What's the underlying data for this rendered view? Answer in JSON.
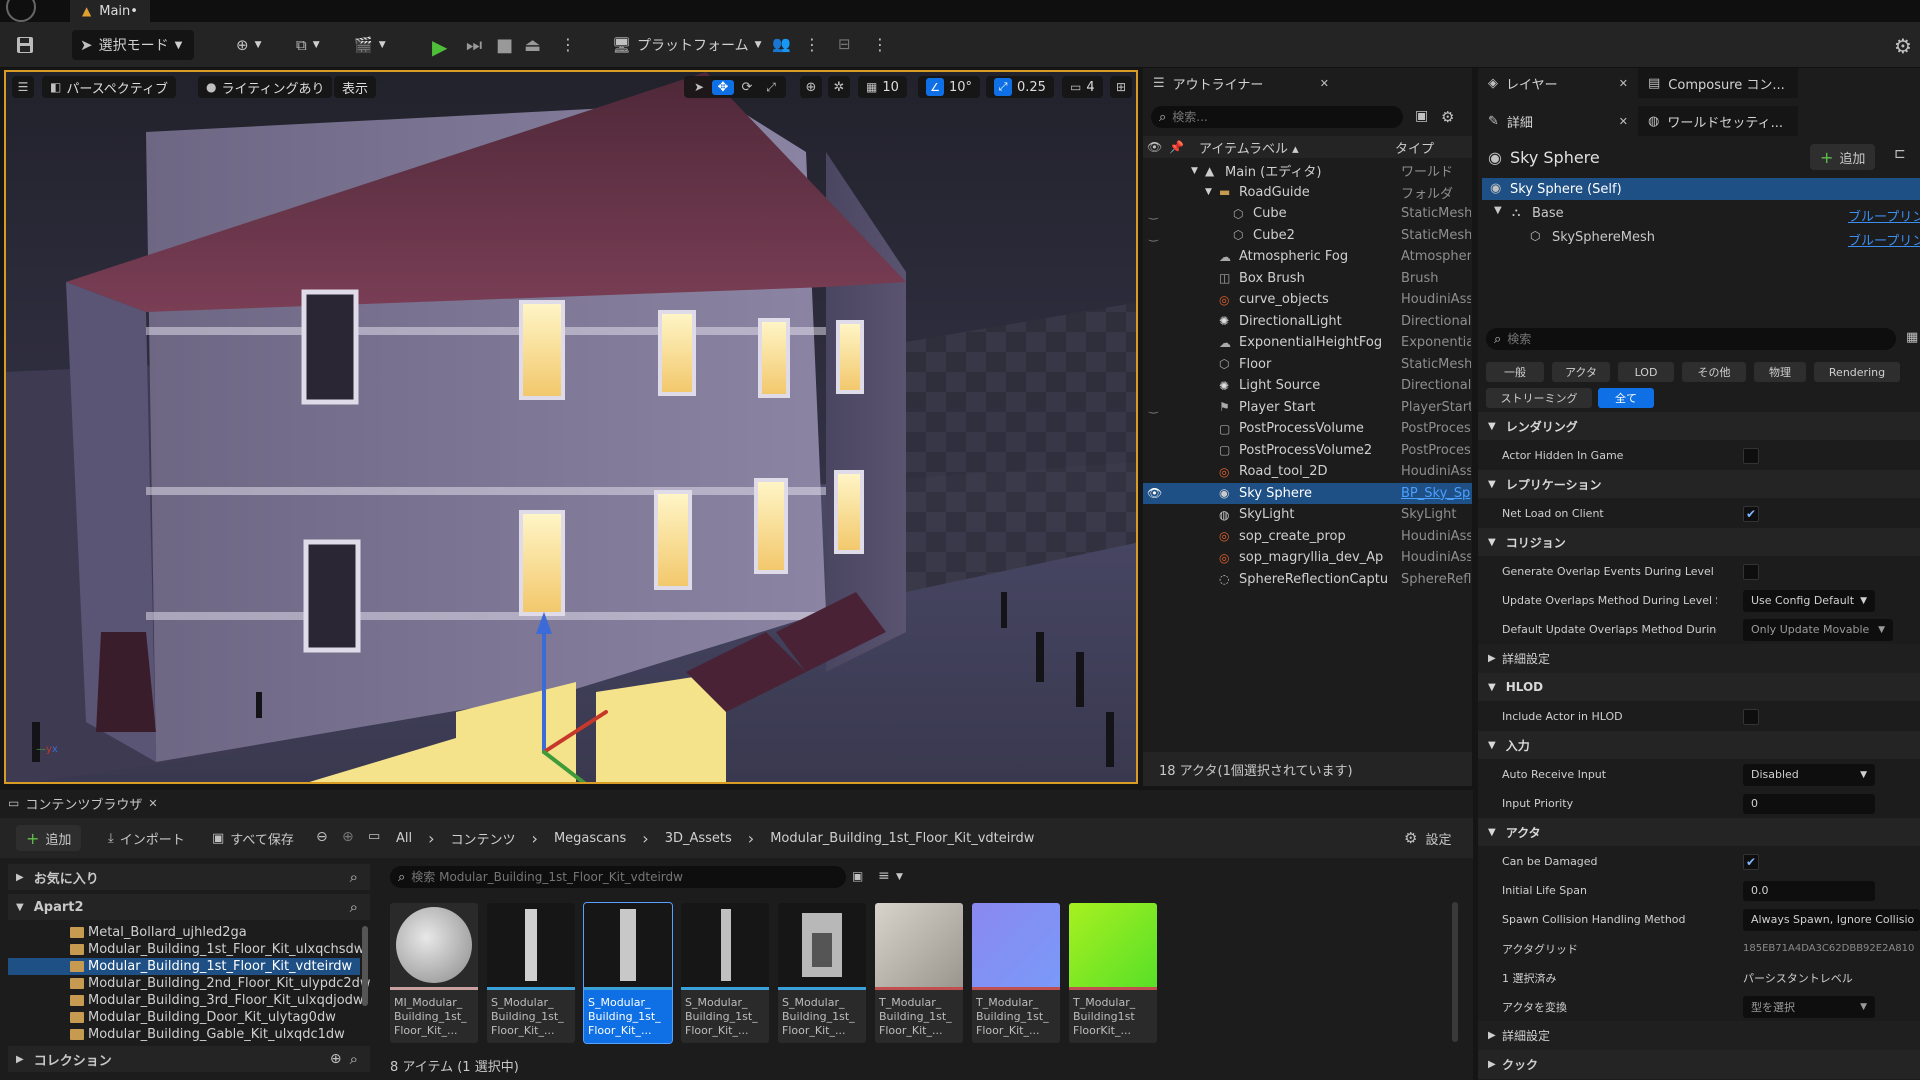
{
  "titlebar": {
    "tab_title": "Main•"
  },
  "toolbar": {
    "select_mode": "選択モード",
    "platform": "プラットフォーム"
  },
  "viewport": {
    "perspective": "パースペクティブ",
    "lighting": "ライティングあり",
    "show": "表示",
    "grid_snap": "10",
    "angle_snap": "10°",
    "scale_snap": "0.25",
    "camera_speed": "4"
  },
  "outliner": {
    "tab": "アウトライナー",
    "search_placeholder": "検索...",
    "col_label": "アイテムラベル ▴",
    "col_type": "タイプ",
    "rows": [
      {
        "name": "Main (エディタ)",
        "type": "ワールド"
      },
      {
        "name": "RoadGuide",
        "type": "フォルダ"
      },
      {
        "name": "Cube",
        "type": "StaticMesh"
      },
      {
        "name": "Cube2",
        "type": "StaticMesh"
      },
      {
        "name": "Atmospheric Fog",
        "type": "Atmospheri"
      },
      {
        "name": "Box Brush",
        "type": "Brush"
      },
      {
        "name": "curve_objects",
        "type": "HoudiniAss"
      },
      {
        "name": "DirectionalLight",
        "type": "Directionall"
      },
      {
        "name": "ExponentialHeightFog",
        "type": "Exponential"
      },
      {
        "name": "Floor",
        "type": "StaticMesh"
      },
      {
        "name": "Light Source",
        "type": "Directionall"
      },
      {
        "name": "Player Start",
        "type": "PlayerStart"
      },
      {
        "name": "PostProcessVolume",
        "type": "PostProces"
      },
      {
        "name": "PostProcessVolume2",
        "type": "PostProces"
      },
      {
        "name": "Road_tool_2D",
        "type": "HoudiniAss"
      },
      {
        "name": "Sky Sphere",
        "type": "BP_Sky_Sp"
      },
      {
        "name": "SkyLight",
        "type": "SkyLight"
      },
      {
        "name": "sop_create_prop",
        "type": "HoudiniAss"
      },
      {
        "name": "sop_magryllia_dev_Ap",
        "type": "HoudiniAss"
      },
      {
        "name": "SphereReflectionCaptu",
        "type": "SphereRefle"
      }
    ],
    "status": "18 アクタ(1個選択されています)"
  },
  "layers": {
    "tab": "レイヤー",
    "tab2": "Composure コン..."
  },
  "details": {
    "tab": "詳細",
    "tab2": "ワールドセッティ...",
    "actor_name": "Sky Sphere",
    "add_label": "追加",
    "components": [
      {
        "name": "Sky Sphere (Self)",
        "link": ""
      },
      {
        "name": "Base",
        "link": "ブループリン"
      },
      {
        "name": "SkySphereMesh",
        "link": "ブループリン"
      }
    ],
    "search_placeholder": "検索",
    "filter_tabs": [
      "一般",
      "アクタ",
      "LOD",
      "その他",
      "物理",
      "Rendering"
    ],
    "filter_tabs2": [
      "ストリーミング",
      "全て"
    ],
    "cat_rendering": "レンダリング",
    "actor_hidden": "Actor Hidden In Game",
    "cat_replication": "レプリケーション",
    "net_load": "Net Load on Client",
    "cat_collision": "コリジョン",
    "gen_overlap": "Generate Overlap Events During Level St...",
    "update_overlap": "Update Overlaps Method During Level St...",
    "update_overlap_val": "Use Config Default",
    "default_overlap": "Default Update Overlaps Method During...",
    "default_overlap_val": "Only Update Movable",
    "advanced": "詳細設定",
    "cat_hlod": "HLOD",
    "include_hlod": "Include Actor in HLOD",
    "cat_input": "入力",
    "auto_input": "Auto Receive Input",
    "auto_input_val": "Disabled",
    "input_priority": "Input Priority",
    "input_priority_val": "0",
    "cat_actor": "アクタ",
    "can_damaged": "Can be Damaged",
    "initial_life": "Initial Life Span",
    "initial_life_val": "0.0",
    "spawn_collision": "Spawn Collision Handling Method",
    "spawn_collision_val": "Always Spawn, Ignore Collisio",
    "actor_guid": "アクタグリッド",
    "actor_guid_val": "185EB71A4DA3C62DBB92E2A810",
    "selected": "1 選択済み",
    "selected_val": "パーシスタントレベル",
    "convert": "アクタを変換",
    "convert_val": "型を選択",
    "advanced2": "詳細設定",
    "cat_cook": "クック"
  },
  "content": {
    "tab": "コンテンツブラウザ",
    "add": "追加",
    "import": "インポート",
    "save_all": "すべて保存",
    "breadcrumb": [
      "All",
      "コンテンツ",
      "Megascans",
      "3D_Assets",
      "Modular_Building_1st_Floor_Kit_vdteirdw"
    ],
    "settings": "設定",
    "favorites": "お気に入り",
    "project": "Apart2",
    "folders": [
      "Metal_Bollard_ujhled2ga",
      "Modular_Building_1st_Floor_Kit_ulxqchsdw",
      "Modular_Building_1st_Floor_Kit_vdteirdw",
      "Modular_Building_2nd_Floor_Kit_ulypdc2dw",
      "Modular_Building_3rd_Floor_Kit_ulxqdjodw",
      "Modular_Building_Door_Kit_ulytag0dw",
      "Modular_Building_Gable_Kit_ulxqdc1dw"
    ],
    "collections": "コレクション",
    "search_placeholder": "検索 Modular_Building_1st_Floor_Kit_vdteirdw",
    "assets": [
      "MI_Modular_\nBuilding_1st_\nFloor_Kit_...",
      "S_Modular_\nBuilding_1st_\nFloor_Kit_...",
      "S_Modular_\nBuilding_1st_\nFloor_Kit_...",
      "S_Modular_\nBuilding_1st_\nFloor_Kit_...",
      "S_Modular_\nBuilding_1st_\nFloor_Kit_...",
      "T_Modular_\nBuilding_1st_\nFloor_Kit_...",
      "T_Modular_\nBuilding_1st_\nFloor_Kit_...",
      "T_Modular_\nBuilding1st\nFloorKit_..."
    ],
    "status": "8 アイテム (1 選択中)"
  },
  "colors": {
    "accent": "#0e70e4",
    "selection": "#1e4f85",
    "gizmo_x": "#c8382a",
    "gizmo_y": "#3f9a3a",
    "gizmo_z": "#3b6bd6"
  }
}
